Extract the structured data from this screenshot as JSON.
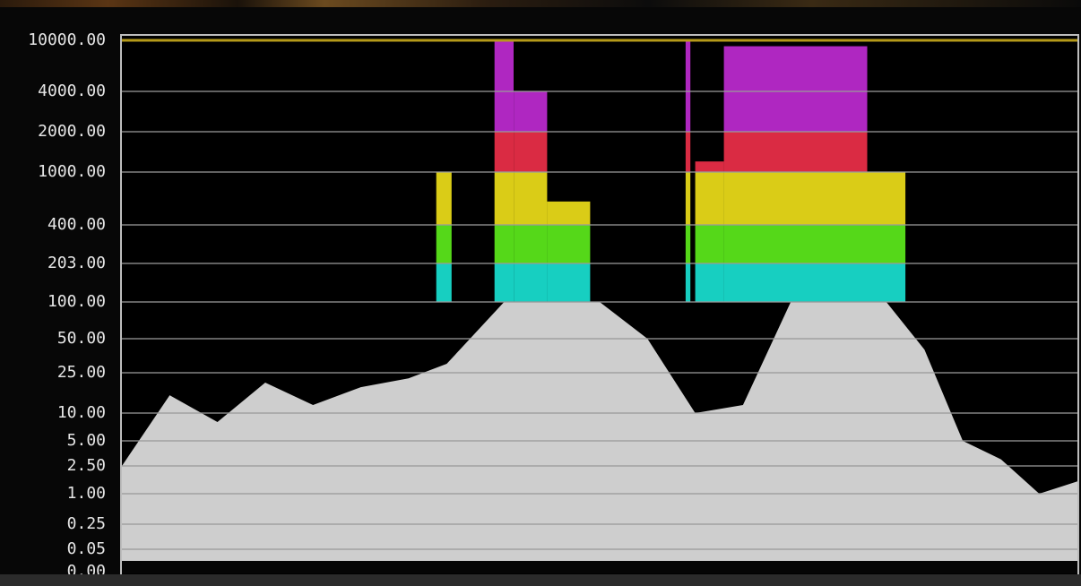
{
  "chart_data": {
    "type": "scatter",
    "title": "",
    "xlabel": "",
    "ylabel": "",
    "yscale": "nonlinear (PQ-style nits scale)",
    "ylim": [
      0,
      10000
    ],
    "y_ticks": [
      "10000.00",
      "4000.00",
      "2000.00",
      "1000.00",
      "400.00",
      "203.00",
      "100.00",
      "50.00",
      "25.00",
      "10.00",
      "5.00",
      "2.50",
      "1.00",
      "0.25",
      "0.05",
      "0.00"
    ],
    "x_range": [
      0,
      1
    ],
    "grid": true,
    "legend": "none",
    "colors": {
      "sdr_points": "#e0e0e0",
      "band_100_203": "#19e6d6",
      "band_203_400": "#5ef01c",
      "band_400_1000": "#f2e21a",
      "band_1000_2000": "#f2304a",
      "band_2000_10000": "#c22bd6",
      "peak_line": "#b59a1a",
      "grid": "#9a9a9a"
    },
    "series": [
      {
        "values": [
          {
            "x": 0.0,
            "y_top": 2.5
          },
          {
            "x": 0.05,
            "y_top": 15
          },
          {
            "x": 0.1,
            "y_top": 8
          },
          {
            "x": 0.15,
            "y_top": 20
          },
          {
            "x": 0.2,
            "y_top": 12
          },
          {
            "x": 0.25,
            "y_top": 18
          },
          {
            "x": 0.3,
            "y_top": 22
          },
          {
            "x": 0.34,
            "y_top": 30
          },
          {
            "x": 0.4,
            "y_top": 100
          },
          {
            "x": 0.45,
            "y_top": 100
          },
          {
            "x": 0.5,
            "y_top": 100
          },
          {
            "x": 0.55,
            "y_top": 50
          },
          {
            "x": 0.6,
            "y_top": 10
          },
          {
            "x": 0.65,
            "y_top": 12
          },
          {
            "x": 0.7,
            "y_top": 100
          },
          {
            "x": 0.75,
            "y_top": 100
          },
          {
            "x": 0.8,
            "y_top": 100
          },
          {
            "x": 0.84,
            "y_top": 40
          },
          {
            "x": 0.88,
            "y_top": 5
          },
          {
            "x": 0.92,
            "y_top": 3
          },
          {
            "x": 0.96,
            "y_top": 1.0
          },
          {
            "x": 1.0,
            "y_top": 1.5
          }
        ]
      },
      {
        "values": [
          {
            "x0": 0.329,
            "x1": 0.345,
            "y_top": 1000
          },
          {
            "x0": 0.39,
            "x1": 0.41,
            "y_top": 10000
          },
          {
            "x0": 0.41,
            "x1": 0.445,
            "y_top": 4000
          },
          {
            "x0": 0.445,
            "x1": 0.49,
            "y_top": 600
          },
          {
            "x0": 0.59,
            "x1": 0.595,
            "y_top": 10000
          },
          {
            "x0": 0.6,
            "x1": 0.63,
            "y_top": 1200
          },
          {
            "x0": 0.63,
            "x1": 0.78,
            "y_top": 9000
          },
          {
            "x0": 0.78,
            "x1": 0.82,
            "y_top": 1000
          }
        ]
      }
    ]
  }
}
